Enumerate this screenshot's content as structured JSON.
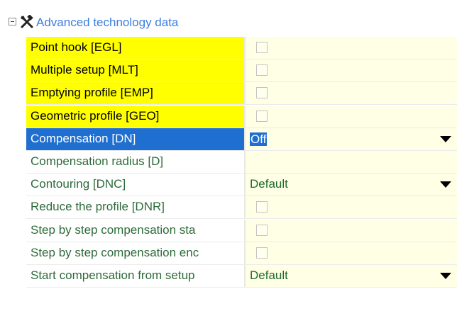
{
  "category": {
    "title": "Advanced technology data",
    "expander_state": "expanded",
    "icon": "tools-icon"
  },
  "rows": [
    {
      "label": "Point hook [EGL]",
      "value_type": "checkbox",
      "checked": false,
      "mandatory": true
    },
    {
      "label": "Multiple setup [MLT]",
      "value_type": "checkbox",
      "checked": false,
      "mandatory": true
    },
    {
      "label": "Emptying profile [EMP]",
      "value_type": "checkbox",
      "checked": false,
      "mandatory": true
    },
    {
      "label": "Geometric profile [GEO]",
      "value_type": "checkbox",
      "checked": false,
      "mandatory": true
    },
    {
      "label": "Compensation [DN]",
      "value_type": "combo",
      "value": "Off",
      "selected": true
    },
    {
      "label": "Compensation radius [D]",
      "value_type": "text",
      "value": ""
    },
    {
      "label": "Contouring [DNC]",
      "value_type": "combo",
      "value": "Default"
    },
    {
      "label": "Reduce the profile [DNR]",
      "value_type": "checkbox",
      "checked": false
    },
    {
      "label": "Step by step compensation sta",
      "value_type": "checkbox",
      "checked": false
    },
    {
      "label": "Step by step compensation enc",
      "value_type": "checkbox",
      "checked": false
    },
    {
      "label": "Start compensation from setup",
      "value_type": "combo",
      "value": "Default"
    }
  ],
  "colors": {
    "mandatory_bg": "#ffff00",
    "selected_bg": "#1f6fd0",
    "value_bg": "#ffffe6",
    "label_text": "#2e6b3a",
    "category_text": "#3b7de0"
  }
}
